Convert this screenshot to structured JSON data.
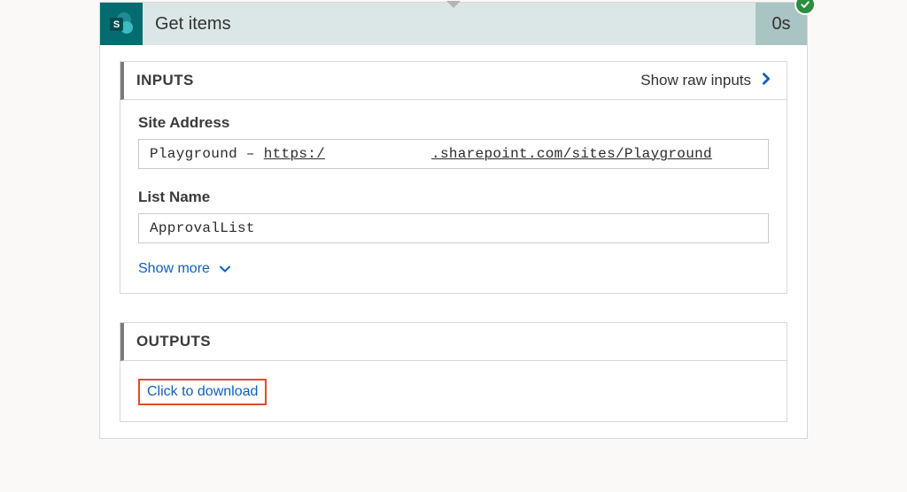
{
  "action": {
    "title": "Get items",
    "duration": "0s",
    "status": "success"
  },
  "inputs": {
    "section_title": "INPUTS",
    "raw_link_label": "Show raw inputs",
    "site_address": {
      "label": "Site Address",
      "prefix": "Playground – ",
      "url_proto": "https:/",
      "url_rest": ".sharepoint.com/sites/Playground"
    },
    "list_name": {
      "label": "List Name",
      "value": "ApprovalList"
    },
    "show_more_label": "Show more"
  },
  "outputs": {
    "section_title": "OUTPUTS",
    "download_label": "Click to download"
  },
  "icon": {
    "letter": "S"
  }
}
